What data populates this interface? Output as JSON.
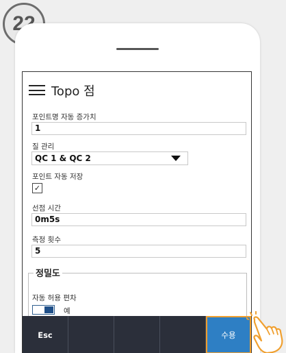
{
  "step_number": "22",
  "screen": {
    "title": "Topo 점",
    "fields": {
      "point_name_increment": {
        "label": "포인트명 자동 증가치",
        "value": "1"
      },
      "quality_control": {
        "label": "질 관리",
        "value": "QC 1 & QC 2"
      },
      "auto_store": {
        "label": "포인트 자동 저장",
        "checked_mark": "✓"
      },
      "occupation_time": {
        "label": "선점 시간",
        "value": "0m5s"
      },
      "measurement_count": {
        "label": "측정 횟수",
        "value": "5"
      }
    },
    "precision_group": {
      "title": "정밀도",
      "auto_tolerance": {
        "label": "자동 허용 편차",
        "value": "예"
      }
    },
    "softkeys": [
      "Esc",
      "",
      "",
      "",
      "수용"
    ]
  },
  "colors": {
    "softkey_bar": "#2b2f3a",
    "accept_button": "#2e7fc4",
    "highlight": "#f0a030"
  },
  "icons": [
    "menu-icon",
    "dropdown-arrow-icon",
    "check-icon",
    "pointing-hand-icon"
  ]
}
